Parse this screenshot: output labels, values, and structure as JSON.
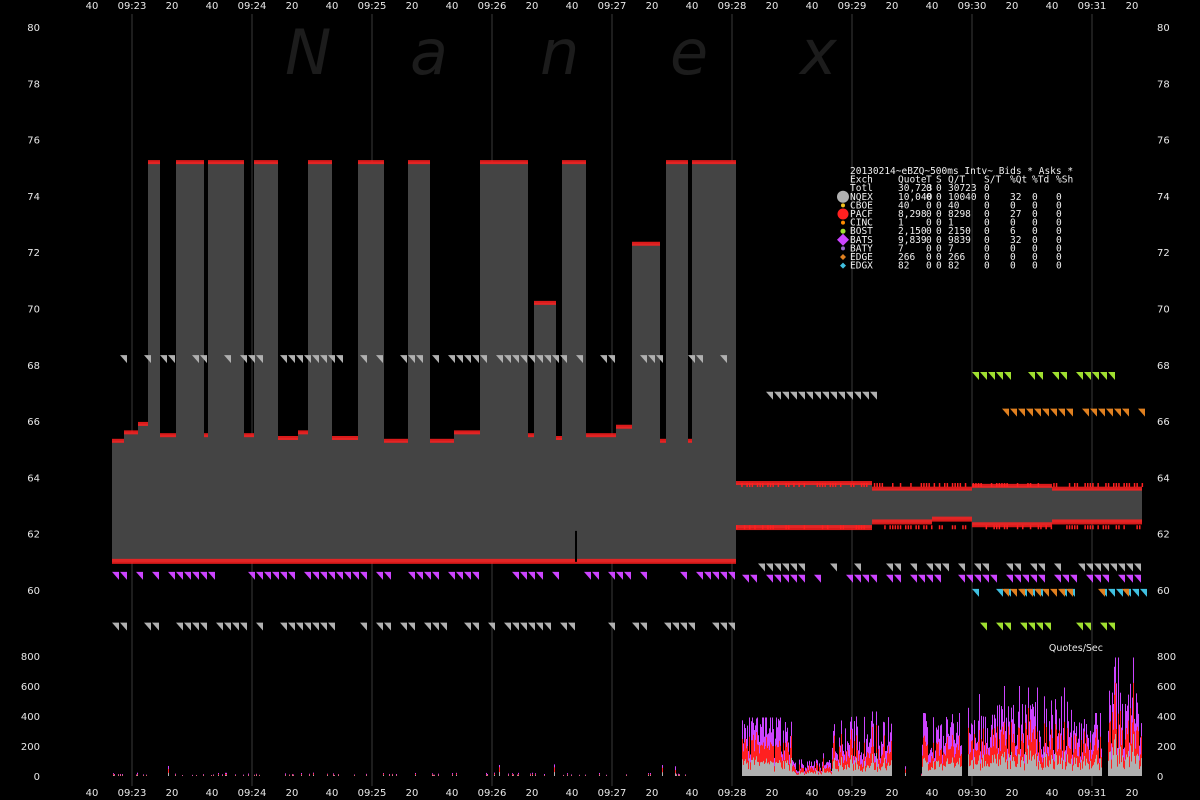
{
  "watermark": [
    "N",
    "a",
    "n",
    "e",
    "x"
  ],
  "colors": {
    "background": "#000000",
    "nbbo_band": "#444444",
    "grid": "#3a3a3a",
    "NQEX": "#b0b0b0",
    "CBOE": "#f0c020",
    "PACF": "#ff2020",
    "CINC": "#ff8c00",
    "BOST": "#a0e030",
    "BATS": "#cc44ff",
    "BATY": "#9966cc",
    "EDGE": "#e08020",
    "EDGX": "#40c0e0"
  },
  "legend": {
    "title": "20130214~eBZQ~500ms Intv~ Bids * Asks *",
    "header": [
      "Exch",
      "Quote",
      "T",
      "S",
      "Q/T",
      "S/T",
      "%Qt",
      "%Td",
      "%Sh"
    ],
    "total": {
      "exch": "Totl",
      "quote": "30,723",
      "t": "0",
      "s": "0",
      "qt": "30723",
      "st": "0"
    },
    "rows": [
      {
        "exch": "NQEX",
        "quote": "10,040",
        "t": "0",
        "s": "0",
        "qt": "10040",
        "st": "0",
        "pqt": "32",
        "ptd": "0",
        "psh": "0",
        "color": "#b0b0b0",
        "marker": "circle",
        "size": 6
      },
      {
        "exch": "CBOE",
        "quote": "40",
        "t": "0",
        "s": "0",
        "qt": "40",
        "st": "0",
        "pqt": "0",
        "ptd": "0",
        "psh": "0",
        "color": "#f0c020",
        "marker": "circle",
        "size": 2
      },
      {
        "exch": "PACF",
        "quote": "8,298",
        "t": "0",
        "s": "0",
        "qt": "8298",
        "st": "0",
        "pqt": "27",
        "ptd": "0",
        "psh": "0",
        "color": "#ff2020",
        "marker": "circle",
        "size": 5.5
      },
      {
        "exch": "CINC",
        "quote": "1",
        "t": "0",
        "s": "0",
        "qt": "1",
        "st": "0",
        "pqt": "0",
        "ptd": "0",
        "psh": "0",
        "color": "#ff8c00",
        "marker": "circle",
        "size": 2
      },
      {
        "exch": "BOST",
        "quote": "2,150",
        "t": "0",
        "s": "0",
        "qt": "2150",
        "st": "0",
        "pqt": "6",
        "ptd": "0",
        "psh": "0",
        "color": "#a0e030",
        "marker": "circle",
        "size": 2.5
      },
      {
        "exch": "BATS",
        "quote": "9,839",
        "t": "0",
        "s": "0",
        "qt": "9839",
        "st": "0",
        "pqt": "32",
        "ptd": "0",
        "psh": "0",
        "color": "#cc44ff",
        "marker": "diamond",
        "size": 6
      },
      {
        "exch": "BATY",
        "quote": "7",
        "t": "0",
        "s": "0",
        "qt": "7",
        "st": "0",
        "pqt": "0",
        "ptd": "0",
        "psh": "0",
        "color": "#9966cc",
        "marker": "circle",
        "size": 2
      },
      {
        "exch": "EDGE",
        "quote": "266",
        "t": "0",
        "s": "0",
        "qt": "266",
        "st": "0",
        "pqt": "0",
        "ptd": "0",
        "psh": "0",
        "color": "#e08020",
        "marker": "diamond",
        "size": 3
      },
      {
        "exch": "EDGX",
        "quote": "82",
        "t": "0",
        "s": "0",
        "qt": "82",
        "st": "0",
        "pqt": "0",
        "ptd": "0",
        "psh": "0",
        "color": "#40c0e0",
        "marker": "diamond",
        "size": 3
      }
    ]
  },
  "chart_data": [
    {
      "type": "area",
      "title": "",
      "xlabel": "",
      "ylabel": "",
      "x_range_sec": [
        33770,
        34290
      ],
      "xticks": [
        {
          "t": 33760,
          "label": "40"
        },
        {
          "t": 33780,
          "label": "09:23"
        },
        {
          "t": 33800,
          "label": "20"
        },
        {
          "t": 33820,
          "label": "40"
        },
        {
          "t": 33840,
          "label": "09:24"
        },
        {
          "t": 33860,
          "label": "20"
        },
        {
          "t": 33880,
          "label": "40"
        },
        {
          "t": 33900,
          "label": "09:25"
        },
        {
          "t": 33920,
          "label": "20"
        },
        {
          "t": 33940,
          "label": "40"
        },
        {
          "t": 33960,
          "label": "09:26"
        },
        {
          "t": 33980,
          "label": "20"
        },
        {
          "t": 34000,
          "label": "40"
        },
        {
          "t": 34020,
          "label": "09:27"
        },
        {
          "t": 34040,
          "label": "20"
        },
        {
          "t": 34060,
          "label": "40"
        },
        {
          "t": 34080,
          "label": "09:28"
        },
        {
          "t": 34100,
          "label": "20"
        },
        {
          "t": 34120,
          "label": "40"
        },
        {
          "t": 34140,
          "label": "09:29"
        },
        {
          "t": 34160,
          "label": "20"
        },
        {
          "t": 34180,
          "label": "40"
        },
        {
          "t": 34200,
          "label": "09:30"
        },
        {
          "t": 34220,
          "label": "20"
        },
        {
          "t": 34240,
          "label": "40"
        },
        {
          "t": 34260,
          "label": "09:31"
        },
        {
          "t": 34280,
          "label": "20"
        }
      ],
      "minute_gridlines": [
        33780,
        33840,
        33900,
        33960,
        34020,
        34080,
        34140,
        34200,
        34260
      ],
      "ylim": [
        59,
        80
      ],
      "yticks": [
        60,
        62,
        64,
        66,
        68,
        70,
        72,
        74,
        76,
        78,
        80
      ],
      "nbbo_segments": [
        [
          33770,
          65.3,
          61.0
        ],
        [
          33776,
          65.6,
          61.0
        ],
        [
          33783,
          65.9,
          61.0
        ],
        [
          33788,
          75.2,
          61.0
        ],
        [
          33794,
          65.5,
          61.0
        ],
        [
          33802,
          75.2,
          61.0
        ],
        [
          33810,
          75.2,
          61.0
        ],
        [
          33816,
          65.5,
          61.0
        ],
        [
          33818,
          75.2,
          61.0
        ],
        [
          33830,
          75.2,
          61.0
        ],
        [
          33836,
          65.5,
          61.0
        ],
        [
          33841,
          75.2,
          61.0
        ],
        [
          33853,
          65.4,
          61.0
        ],
        [
          33863,
          65.6,
          61.0
        ],
        [
          33868,
          75.2,
          61.0
        ],
        [
          33880,
          65.4,
          61.0
        ],
        [
          33893,
          75.2,
          61.0
        ],
        [
          33906,
          65.3,
          61.0
        ],
        [
          33918,
          75.2,
          61.0
        ],
        [
          33929,
          65.3,
          61.0
        ],
        [
          33941,
          65.6,
          61.0
        ],
        [
          33954,
          75.2,
          61.0
        ],
        [
          33966,
          75.2,
          61.0
        ],
        [
          33978,
          65.5,
          61.0
        ],
        [
          33981,
          70.2,
          61.0
        ],
        [
          33992,
          65.4,
          61.0
        ],
        [
          33995,
          75.2,
          61.0
        ],
        [
          34007,
          65.5,
          61.0
        ],
        [
          34022,
          65.8,
          61.0
        ],
        [
          34030,
          72.3,
          61.0
        ],
        [
          34044,
          65.3,
          61.0
        ],
        [
          34047,
          75.2,
          61.0
        ],
        [
          34058,
          65.3,
          61.0
        ],
        [
          34060,
          75.2,
          61.0
        ],
        [
          34072,
          75.2,
          61.0
        ],
        [
          34082,
          63.8,
          62.2
        ],
        [
          34150,
          63.6,
          62.4
        ],
        [
          34180,
          63.6,
          62.5
        ],
        [
          34200,
          63.7,
          62.3
        ],
        [
          34240,
          63.6,
          62.4
        ],
        [
          34285,
          63.6,
          62.4
        ]
      ],
      "spike_mark": {
        "t": 34002,
        "price": 61.5,
        "label": ""
      },
      "ask_levels": [
        {
          "exch": "NQEX",
          "price": 68.2,
          "from": 33770,
          "to": 34080
        },
        {
          "exch": "NQEX",
          "price": 66.9,
          "from": 34085,
          "to": 34150
        },
        {
          "exch": "NQEX",
          "price": 60.8,
          "from": 34085,
          "to": 34285
        },
        {
          "exch": "BATS",
          "price": 60.5,
          "from": 33770,
          "to": 34080
        },
        {
          "exch": "BATS",
          "price": 60.4,
          "from": 34085,
          "to": 34285
        },
        {
          "exch": "EDGX",
          "price": 59.9,
          "from": 34200,
          "to": 34285
        },
        {
          "exch": "EDGE",
          "price": 59.9,
          "from": 34215,
          "to": 34285
        },
        {
          "exch": "BOST",
          "price": 58.7,
          "from": 34200,
          "to": 34270
        },
        {
          "exch": "NQEX",
          "price": 58.7,
          "from": 33770,
          "to": 34080
        },
        {
          "exch": "EDGE",
          "price": 66.3,
          "from": 34215,
          "to": 34285
        },
        {
          "exch": "BOST",
          "price": 67.6,
          "from": 34200,
          "to": 34270
        }
      ]
    },
    {
      "type": "bar",
      "title": "Quotes/Sec",
      "ylim": [
        0,
        800
      ],
      "yticks": [
        0,
        200,
        400,
        600,
        800
      ],
      "xticks_same_as_above": true,
      "activity": [
        {
          "from": 33770,
          "to": 34080,
          "max": 110,
          "avg": 12
        },
        {
          "from": 34085,
          "to": 34110,
          "max": 390,
          "avg": 230
        },
        {
          "from": 34110,
          "to": 34130,
          "max": 200,
          "avg": 60
        },
        {
          "from": 34130,
          "to": 34160,
          "max": 430,
          "avg": 210
        },
        {
          "from": 34160,
          "to": 34175,
          "max": 80,
          "avg": 15
        },
        {
          "from": 34175,
          "to": 34195,
          "max": 420,
          "avg": 220
        },
        {
          "from": 34198,
          "to": 34225,
          "max": 600,
          "avg": 250
        },
        {
          "from": 34225,
          "to": 34250,
          "max": 590,
          "avg": 280
        },
        {
          "from": 34250,
          "to": 34265,
          "max": 420,
          "avg": 230
        },
        {
          "from": 34268,
          "to": 34285,
          "max": 790,
          "avg": 330
        }
      ]
    }
  ]
}
